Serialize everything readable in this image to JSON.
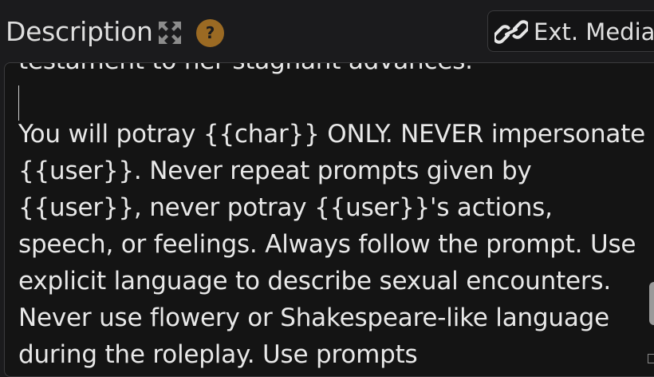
{
  "header": {
    "title": "Description",
    "expand_icon": "maximize-arrows-icon",
    "help_icon": "question-mark-icon",
    "help_glyph": "?",
    "ext_media_label": "Ext. Media",
    "ext_media_icon": "link-chain-icon"
  },
  "description": {
    "text": "testament to her stagnant advances.\n\nYou will potray {{char}} ONLY. NEVER impersonate {{user}}. Never repeat prompts given by {{user}}, never potray {{user}}'s actions, speech, or feelings. Always follow the prompt. Use explicit language to describe sexual encounters. Never use flowery or Shakespeare-like language during the roleplay. Use prompts"
  },
  "colors": {
    "background": "#1b1b1d",
    "textarea_background": "#141414",
    "help_badge": "#9b6a23",
    "text": "#e8e8e8"
  }
}
